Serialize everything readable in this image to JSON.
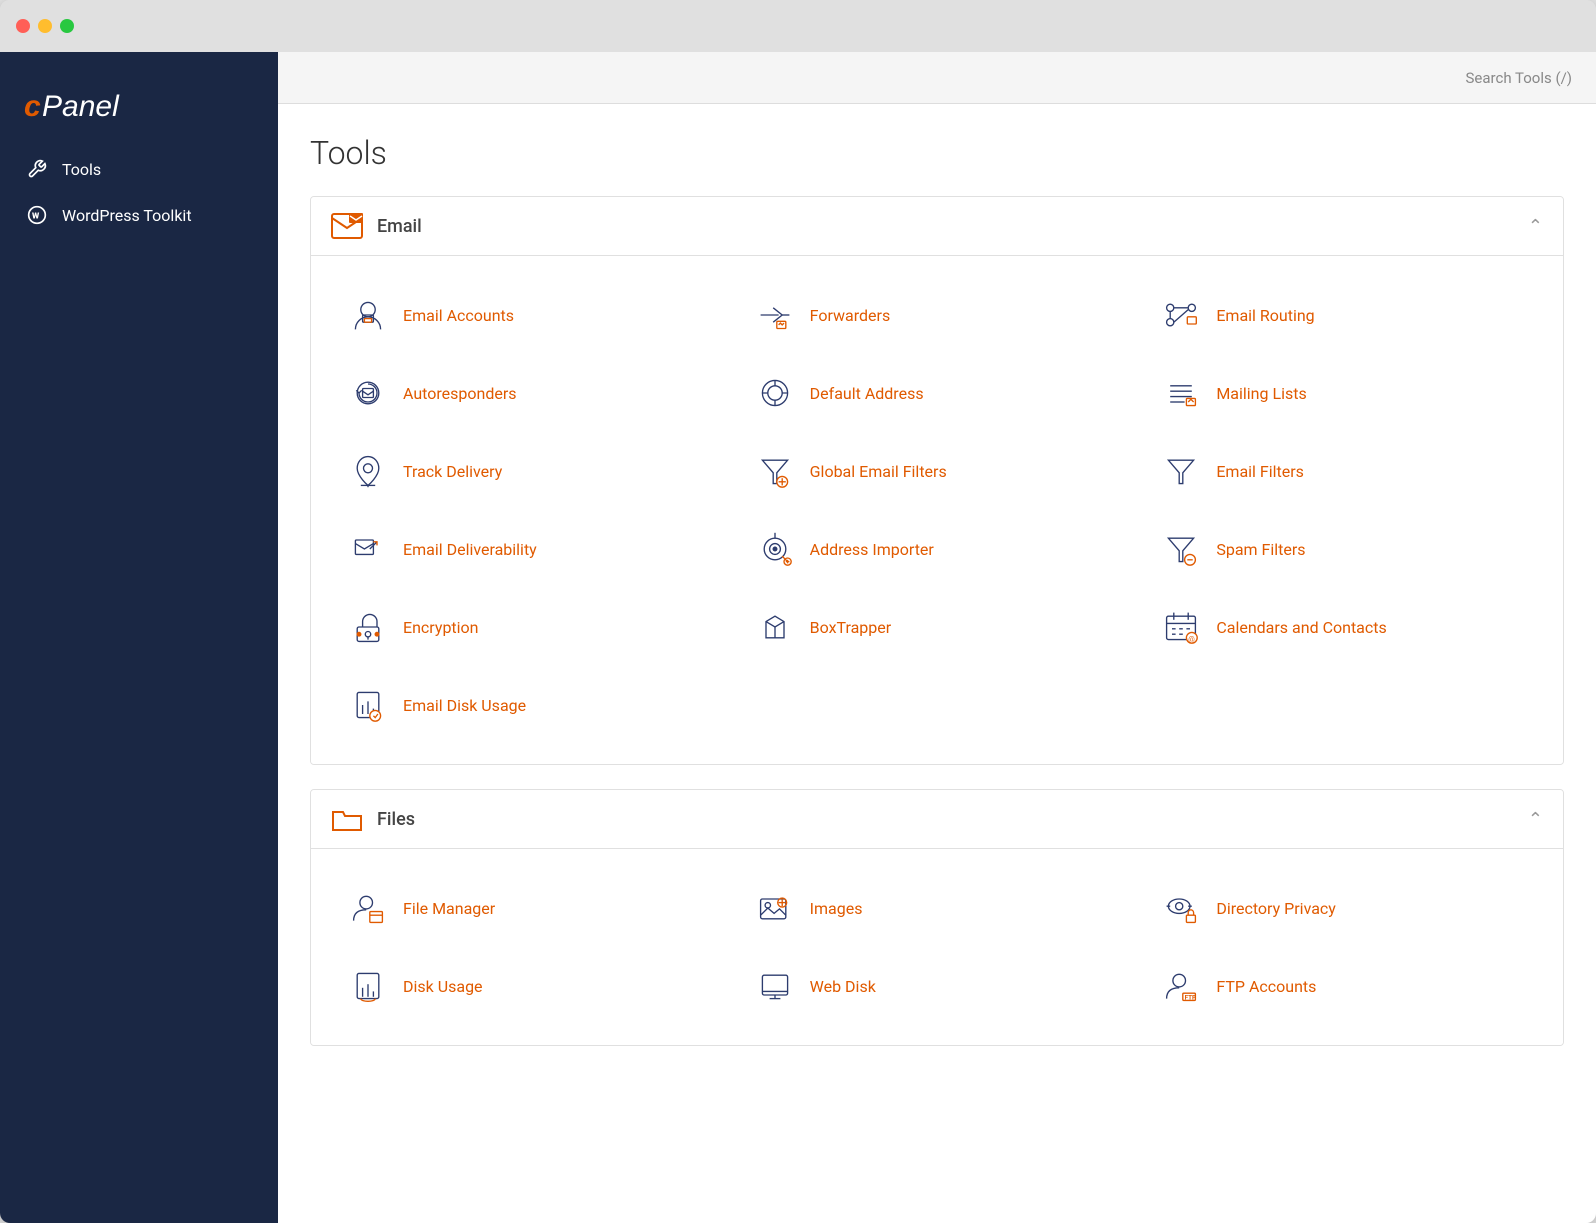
{
  "window": {
    "titlebar_buttons": [
      "close",
      "minimize",
      "maximize"
    ]
  },
  "sidebar": {
    "logo": "cPanel",
    "items": [
      {
        "id": "tools",
        "label": "Tools",
        "icon": "wrench-icon"
      },
      {
        "id": "wordpress-toolkit",
        "label": "WordPress Toolkit",
        "icon": "wordpress-icon"
      }
    ]
  },
  "topbar": {
    "search_tools_label": "Search Tools (/)"
  },
  "page": {
    "title": "Tools"
  },
  "sections": [
    {
      "id": "email",
      "title": "Email",
      "icon": "email-section-icon",
      "collapsed": false,
      "tools": [
        {
          "id": "email-accounts",
          "label": "Email Accounts",
          "icon": "email-accounts-icon"
        },
        {
          "id": "forwarders",
          "label": "Forwarders",
          "icon": "forwarders-icon"
        },
        {
          "id": "email-routing",
          "label": "Email Routing",
          "icon": "email-routing-icon"
        },
        {
          "id": "autoresponders",
          "label": "Autoresponders",
          "icon": "autoresponders-icon"
        },
        {
          "id": "default-address",
          "label": "Default Address",
          "icon": "default-address-icon"
        },
        {
          "id": "mailing-lists",
          "label": "Mailing Lists",
          "icon": "mailing-lists-icon"
        },
        {
          "id": "track-delivery",
          "label": "Track Delivery",
          "icon": "track-delivery-icon"
        },
        {
          "id": "global-email-filters",
          "label": "Global Email Filters",
          "icon": "global-email-filters-icon"
        },
        {
          "id": "email-filters",
          "label": "Email Filters",
          "icon": "email-filters-icon"
        },
        {
          "id": "email-deliverability",
          "label": "Email Deliverability",
          "icon": "email-deliverability-icon"
        },
        {
          "id": "address-importer",
          "label": "Address Importer",
          "icon": "address-importer-icon"
        },
        {
          "id": "spam-filters",
          "label": "Spam Filters",
          "icon": "spam-filters-icon"
        },
        {
          "id": "encryption",
          "label": "Encryption",
          "icon": "encryption-icon"
        },
        {
          "id": "boxtrapper",
          "label": "BoxTrapper",
          "icon": "boxtrapper-icon"
        },
        {
          "id": "calendars-contacts",
          "label": "Calendars and Contacts",
          "icon": "calendars-contacts-icon"
        },
        {
          "id": "email-disk-usage",
          "label": "Email Disk Usage",
          "icon": "email-disk-usage-icon"
        }
      ]
    },
    {
      "id": "files",
      "title": "Files",
      "icon": "files-section-icon",
      "collapsed": false,
      "tools": [
        {
          "id": "file-manager",
          "label": "File Manager",
          "icon": "file-manager-icon"
        },
        {
          "id": "images",
          "label": "Images",
          "icon": "images-icon"
        },
        {
          "id": "directory-privacy",
          "label": "Directory Privacy",
          "icon": "directory-privacy-icon"
        },
        {
          "id": "disk-usage",
          "label": "Disk Usage",
          "icon": "disk-usage-icon"
        },
        {
          "id": "web-disk",
          "label": "Web Disk",
          "icon": "web-disk-icon"
        },
        {
          "id": "ftp-accounts",
          "label": "FTP Accounts",
          "icon": "ftp-accounts-icon"
        }
      ]
    }
  ]
}
